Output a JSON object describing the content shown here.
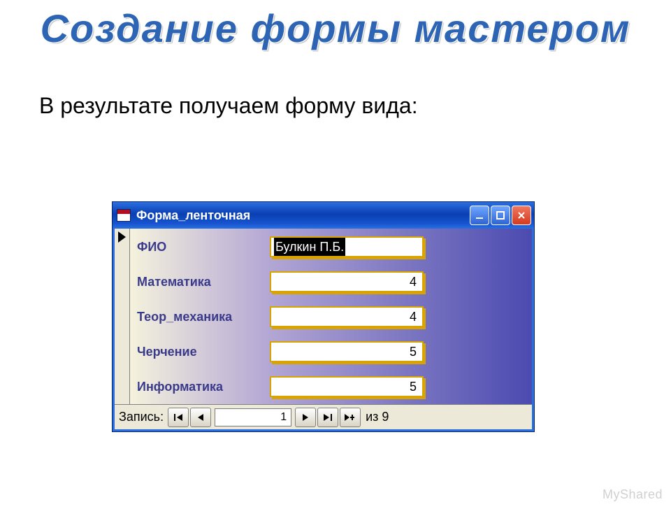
{
  "slide": {
    "title": "Создание формы мастером",
    "text": "В результате получаем форму вида:"
  },
  "window": {
    "title": "Форма_ленточная"
  },
  "form": {
    "fields": [
      {
        "label": "ФИО",
        "value": "Булкин П.Б.",
        "numeric": false,
        "selected": true
      },
      {
        "label": "Математика",
        "value": "4",
        "numeric": true,
        "selected": false
      },
      {
        "label": "Теор_механика",
        "value": "4",
        "numeric": true,
        "selected": false
      },
      {
        "label": "Черчение",
        "value": "5",
        "numeric": true,
        "selected": false
      },
      {
        "label": "Информатика",
        "value": "5",
        "numeric": true,
        "selected": false
      }
    ]
  },
  "nav": {
    "label": "Запись:",
    "current": "1",
    "total_prefix": "из",
    "total": "9"
  },
  "watermark": "MyShared"
}
